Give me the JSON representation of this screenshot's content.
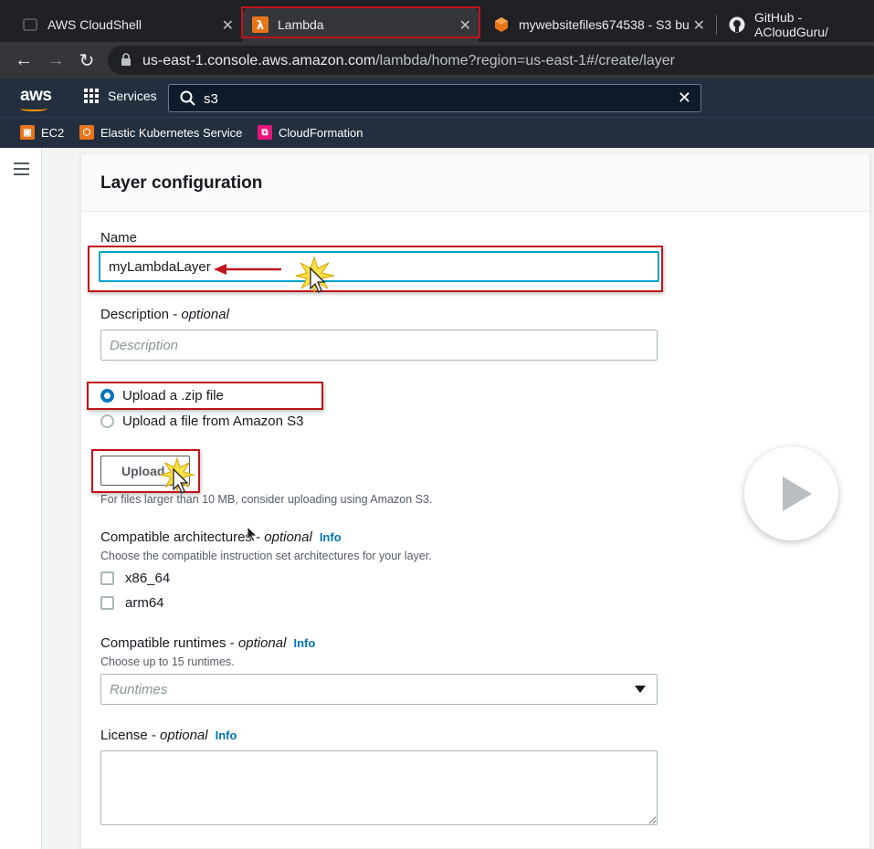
{
  "browser": {
    "tabs": [
      {
        "title": "AWS CloudShell",
        "icon": "cloudshell-icon",
        "active": false
      },
      {
        "title": "Lambda",
        "icon": "lambda-icon",
        "active": true
      },
      {
        "title": "mywebsitefiles674538 - S3 bu",
        "icon": "s3-icon",
        "active": false
      },
      {
        "title": "GitHub - ACloudGuru/",
        "icon": "github-icon",
        "active": false
      }
    ],
    "url_host": "us-east-1.console.aws.amazon.com",
    "url_path": "/lambda/home?region=us-east-1#/create/layer"
  },
  "aws_nav": {
    "logo": "aws",
    "services_label": "Services",
    "search_value": "s3"
  },
  "favorites": [
    {
      "label": "EC2",
      "color": "#e8751a"
    },
    {
      "label": "Elastic Kubernetes Service",
      "color": "#e8751a"
    },
    {
      "label": "CloudFormation",
      "color": "#e7157b"
    }
  ],
  "layer_form": {
    "title": "Layer configuration",
    "name_label": "Name",
    "name_value": "myLambdaLayer",
    "description_label": "Description",
    "description_optional": "optional",
    "description_placeholder": "Description",
    "upload_options": [
      {
        "label": "Upload a .zip file",
        "checked": true
      },
      {
        "label": "Upload a file from Amazon S3",
        "checked": false
      }
    ],
    "upload_button": "Upload",
    "upload_hint": "For files larger than 10 MB, consider uploading using Amazon S3.",
    "architectures_label": "Compatible architectures",
    "architectures_optional": "optional",
    "architectures_info": "Info",
    "architectures_hint": "Choose the compatible instruction set architectures for your layer.",
    "architectures": [
      "x86_64",
      "arm64"
    ],
    "runtimes_label": "Compatible runtimes",
    "runtimes_optional": "optional",
    "runtimes_info": "Info",
    "runtimes_hint": "Choose up to 15 runtimes.",
    "runtimes_placeholder": "Runtimes",
    "license_label": "License",
    "license_optional": "optional",
    "license_info": "Info"
  },
  "colors": {
    "annotation_red": "#c0151c",
    "aws_orange": "#ff9900",
    "link_blue": "#0073bb"
  }
}
